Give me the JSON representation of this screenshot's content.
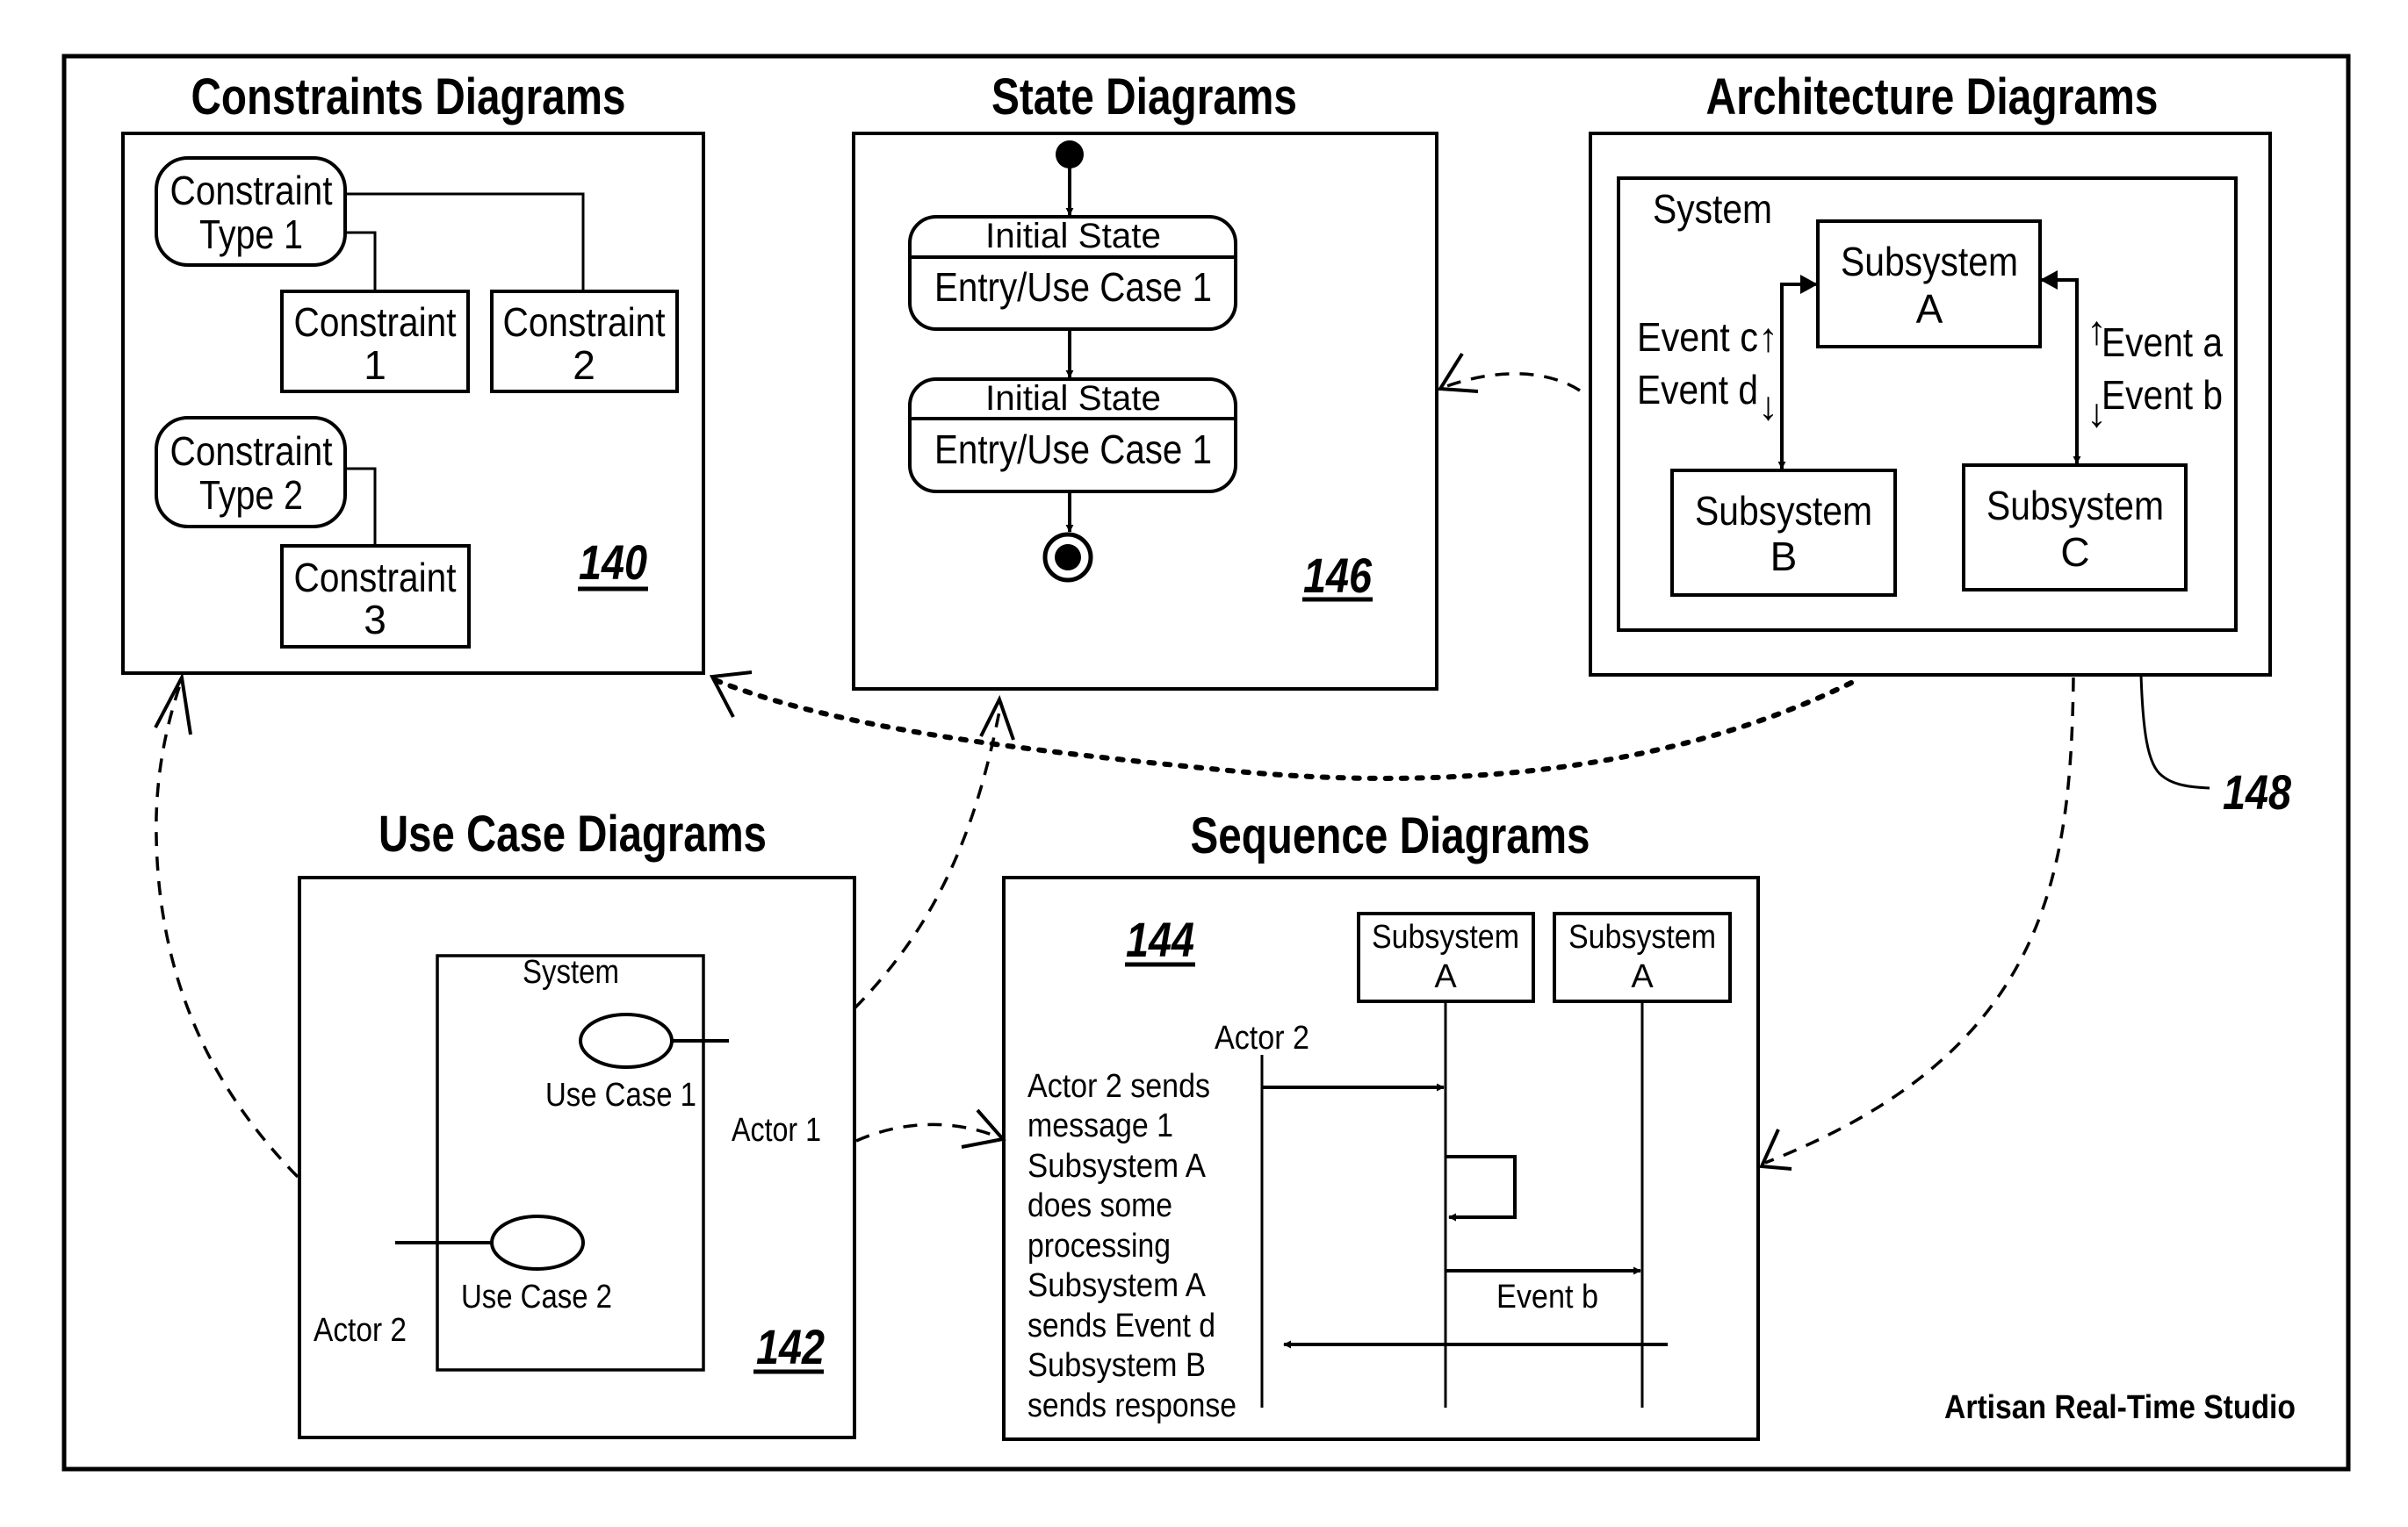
{
  "figure": {
    "brand_label": "Artisan Real-Time Studio",
    "overall_ref": "148"
  },
  "panels": {
    "constraints": {
      "title": "Constraints Diagrams",
      "ref": "140",
      "types": [
        {
          "line1": "Constraint",
          "line2": "Type 1"
        },
        {
          "line1": "Constraint",
          "line2": "Type 2"
        }
      ],
      "constraints": [
        {
          "line1": "Constraint",
          "line2": "1"
        },
        {
          "line1": "Constraint",
          "line2": "2"
        },
        {
          "line1": "Constraint",
          "line2": "3"
        }
      ]
    },
    "state": {
      "title": "State Diagrams",
      "ref": "146",
      "states": [
        {
          "name": "Initial State",
          "action": "Entry/Use Case 1"
        },
        {
          "name": "Initial State",
          "action": "Entry/Use Case 1"
        }
      ]
    },
    "architecture": {
      "title": "Architecture Diagrams",
      "system_label": "System",
      "subsystems": [
        {
          "line1": "Subsystem",
          "line2": "A"
        },
        {
          "line1": "Subsystem",
          "line2": "B"
        },
        {
          "line1": "Subsystem",
          "line2": "C"
        }
      ],
      "events": {
        "c": "Event c",
        "d": "Event d",
        "a": "Event a",
        "b": "Event b"
      },
      "arrows": {
        "up": "↑",
        "down": "↓"
      }
    },
    "use_case": {
      "title": "Use Case Diagrams",
      "ref": "142",
      "system_label": "System",
      "use_cases": [
        "Use Case 1",
        "Use Case 2"
      ],
      "actors": [
        "Actor 1",
        "Actor 2"
      ]
    },
    "sequence": {
      "title": "Sequence Diagrams",
      "ref": "144",
      "lifelines": [
        {
          "line1": "Subsystem",
          "line2": "A"
        },
        {
          "line1": "Subsystem",
          "line2": "A"
        }
      ],
      "actor_label": "Actor 2",
      "event_label": "Event b",
      "narrative": [
        "Actor 2 sends",
        "message 1",
        "Subsystem A",
        "does some",
        "processing",
        "Subsystem A",
        "sends Event d",
        "Subsystem B",
        "sends response"
      ]
    }
  }
}
